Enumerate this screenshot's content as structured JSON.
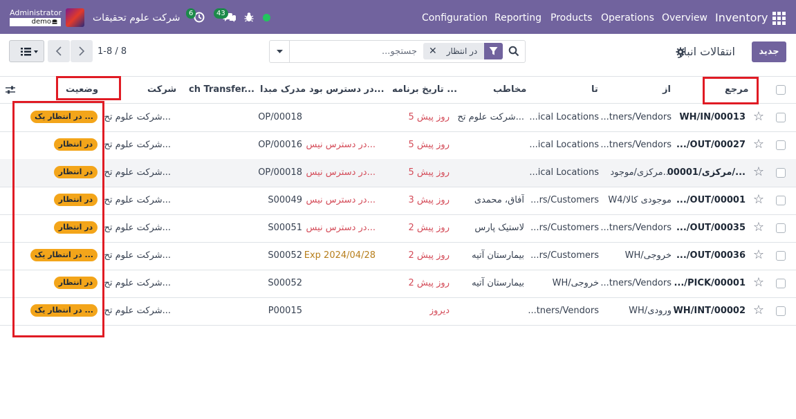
{
  "navbar": {
    "app_name": "Inventory",
    "menu": [
      "Overview",
      "Operations",
      "Products",
      "Reporting",
      "Configuration"
    ],
    "company": "شرکت علوم تحقیقات",
    "user": "Administrator",
    "db": "demo",
    "activity_count": "6",
    "messages_count": "43"
  },
  "control": {
    "new_label": "جدید",
    "title": "انتقالات انبار",
    "search_placeholder": "جستجو...",
    "facet_label": "در انتظار",
    "pager": "1-8 / 8"
  },
  "table": {
    "headers": {
      "reference": "مرجع",
      "from": "از",
      "to": "تا",
      "contact": "مخاطب",
      "scheduled": "تاریخ برنامه ...",
      "availability": "در دسترس بود...",
      "source": "مدرک مبدا",
      "batch": "ch Transfer...",
      "company": "شرکت",
      "status": "وضعیت"
    },
    "rows": [
      {
        "reference": "WH/IN/00013",
        "from": "...tners/Vendors",
        "to": "...ical Locations",
        "contact": "شرکت علوم تح...",
        "scheduled": "5 روز پیش",
        "availability": "",
        "source": "OP/00018",
        "company": "شرکت علوم تح...",
        "status": "در انتظار یک ..."
      },
      {
        "reference": ".../OUT/00027",
        "from": "...tners/Vendors",
        "to": "...ical Locations",
        "contact": "",
        "scheduled": "5 روز پیش",
        "availability": "در دسترس نیس...",
        "source": "OP/00016",
        "company": "شرکت علوم تح...",
        "status": "در انتظار"
      },
      {
        "reference": "مرکزی/00001/...",
        "from": "مرکزی/موجود...",
        "to": "...ical Locations",
        "contact": "",
        "scheduled": "5 روز پیش",
        "availability": "در دسترس نیس...",
        "source": "OP/00018",
        "company": "شرکت علوم تح...",
        "status": "در انتظار"
      },
      {
        "reference": ".../OUT/00001",
        "from": "W4/موجودی کالا",
        "to": "...rs/Customers",
        "contact": "آفاق، محمدی",
        "scheduled": "3 روز پیش",
        "availability": "در دسترس نیس...",
        "source": "S00049",
        "company": "شرکت علوم تح...",
        "status": "در انتظار"
      },
      {
        "reference": ".../OUT/00035",
        "from": "...tners/Vendors",
        "to": "...rs/Customers",
        "contact": "لاستیک پارس",
        "scheduled": "2 روز پیش",
        "availability": "در دسترس نیس...",
        "source": "S00051",
        "company": "شرکت علوم تح...",
        "status": "در انتظار"
      },
      {
        "reference": ".../OUT/00036",
        "from": "WH/خروجی",
        "to": "...rs/Customers",
        "contact": "بیمارستان آتیه",
        "scheduled": "2 روز پیش",
        "availability": "Exp 2024/04/28",
        "source": "S00052",
        "company": "شرکت علوم تح...",
        "status": "در انتظار یک ..."
      },
      {
        "reference": ".../PICK/00001",
        "from": "...tners/Vendors",
        "to": "WH/خروجی",
        "contact": "بیمارستان آتیه",
        "scheduled": "2 روز پیش",
        "availability": "",
        "source": "S00052",
        "company": "شرکت علوم تح...",
        "status": "در انتظار"
      },
      {
        "reference": "WH/INT/00002",
        "from": "WH/ورودی",
        "to": "...tners/Vendors",
        "contact": "",
        "scheduled": "دیروز",
        "availability": "",
        "source": "P00015",
        "company": "شرکت علوم تح...",
        "status": "در انتظار یک ..."
      }
    ]
  },
  "colors": {
    "brand": "#71639e",
    "late": "#d44c59",
    "warning": "#b77e1b",
    "status_pill": "#f3a51a",
    "annotation": "#e01b24"
  },
  "icons": [
    "apps-grid-icon",
    "bug-icon",
    "chat-icon",
    "activity-clock-icon",
    "gear-icon",
    "search-icon",
    "filter-icon",
    "close-icon",
    "caret-down-icon",
    "chevron-left-icon",
    "chevron-right-icon",
    "list-view-icon",
    "star-icon",
    "column-settings-icon"
  ]
}
